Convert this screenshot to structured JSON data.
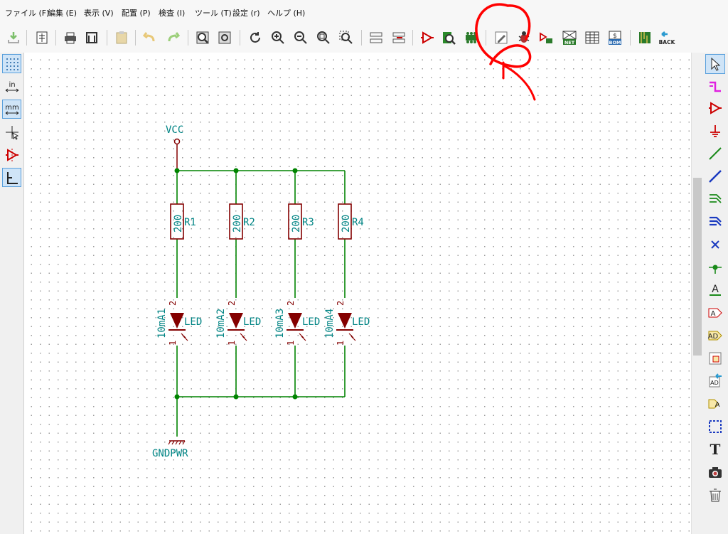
{
  "menu": {
    "items": [
      {
        "label": "ファイル (F)"
      },
      {
        "label": "編集 (E)"
      },
      {
        "label": "表示 (V)"
      },
      {
        "label": "配置 (P)"
      },
      {
        "label": "検査 (I)"
      },
      {
        "label": "ツール (T)"
      },
      {
        "label": "設定 (r)"
      },
      {
        "label": "ヘルプ (H)"
      }
    ]
  },
  "toolbar": {
    "net_label": "NET",
    "bom_label": "BOM",
    "back_label": "BACK"
  },
  "left_toolbar": {
    "unit_in": "in",
    "unit_mm": "mm"
  },
  "right_toolbar": {
    "label_tool": "A",
    "text_tool": "T"
  },
  "schematic": {
    "power_top": "VCC",
    "power_bottom": "GNDPWR",
    "resistors": [
      {
        "ref": "R1",
        "value": "200"
      },
      {
        "ref": "R2",
        "value": "200"
      },
      {
        "ref": "R3",
        "value": "200"
      },
      {
        "ref": "R4",
        "value": "200"
      }
    ],
    "leds": [
      {
        "ref": "10mA1",
        "value": "LED",
        "pin_top": "2",
        "pin_bottom": "1"
      },
      {
        "ref": "10mA2",
        "value": "LED",
        "pin_top": "2",
        "pin_bottom": "1"
      },
      {
        "ref": "10mA3",
        "value": "LED",
        "pin_top": "2",
        "pin_bottom": "1"
      },
      {
        "ref": "10mA4",
        "value": "LED",
        "pin_top": "2",
        "pin_bottom": "1"
      }
    ]
  },
  "colors": {
    "wire": "#008400",
    "component": "#840000",
    "text": "#008484",
    "annotation": "#ff0000"
  }
}
